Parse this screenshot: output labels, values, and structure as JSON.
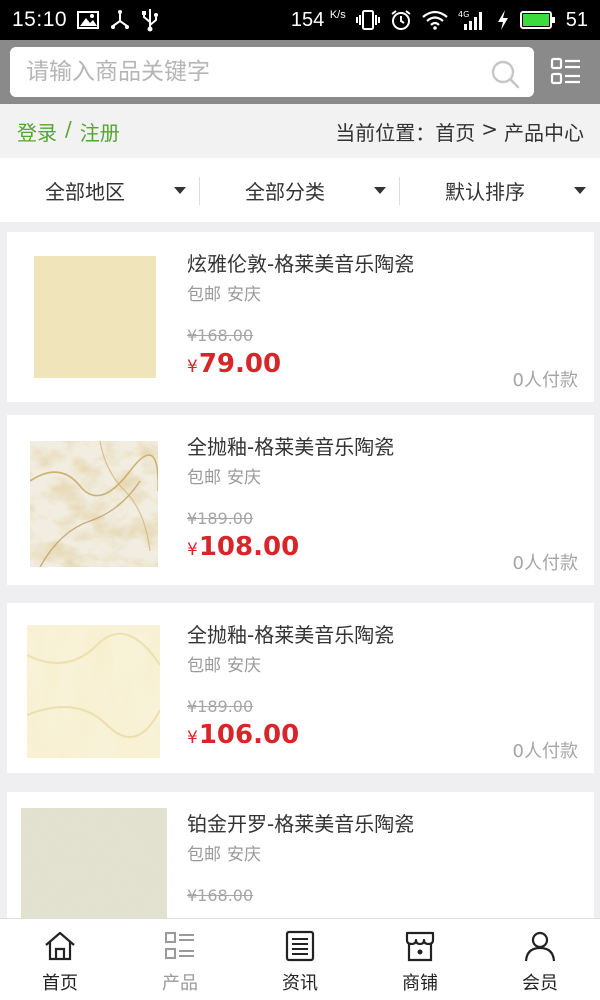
{
  "status_bar": {
    "time": "15:10",
    "speed": "154",
    "speed_unit": "K/s",
    "battery": "51",
    "icons": [
      "image-icon",
      "usb-debug-icon",
      "usb-icon",
      "vibrate-icon",
      "alarm-icon",
      "wifi-icon",
      "signal-4g-icon",
      "charging-icon",
      "battery-icon"
    ]
  },
  "search": {
    "placeholder": "请输入商品关键字"
  },
  "breadcrumb": {
    "login": "登录",
    "separator": "/",
    "register": "注册",
    "location_label": "当前位置：",
    "home": "首页",
    "arrow": ">",
    "current": "产品中心"
  },
  "filters": [
    {
      "label": "全部地区"
    },
    {
      "label": "全部分类"
    },
    {
      "label": "默认排序"
    }
  ],
  "products": [
    {
      "title": "炫雅伦敦-格莱美音乐陶瓷",
      "shipping": "包邮",
      "city": "安庆",
      "old_price": "¥168.00",
      "currency": "¥",
      "price": "79.00",
      "sold": "0人付款"
    },
    {
      "title": "全抛釉-格莱美音乐陶瓷",
      "shipping": "包邮",
      "city": "安庆",
      "old_price": "¥189.00",
      "currency": "¥",
      "price": "108.00",
      "sold": "0人付款"
    },
    {
      "title": "全抛釉-格莱美音乐陶瓷",
      "shipping": "包邮",
      "city": "安庆",
      "old_price": "¥189.00",
      "currency": "¥",
      "price": "106.00",
      "sold": "0人付款"
    },
    {
      "title": "铂金开罗-格莱美音乐陶瓷",
      "shipping": "包邮",
      "city": "安庆",
      "old_price": "¥168.00",
      "currency": "¥",
      "price": "",
      "sold": ""
    }
  ],
  "nav": [
    {
      "label": "首页",
      "icon": "home-icon"
    },
    {
      "label": "产品",
      "icon": "product-list-icon"
    },
    {
      "label": "资讯",
      "icon": "news-icon"
    },
    {
      "label": "商铺",
      "icon": "store-icon"
    },
    {
      "label": "会员",
      "icon": "member-icon"
    }
  ],
  "colors": {
    "accent_green": "#55a532",
    "price_red": "#d6262a",
    "header_gray": "#8a8a8a"
  }
}
